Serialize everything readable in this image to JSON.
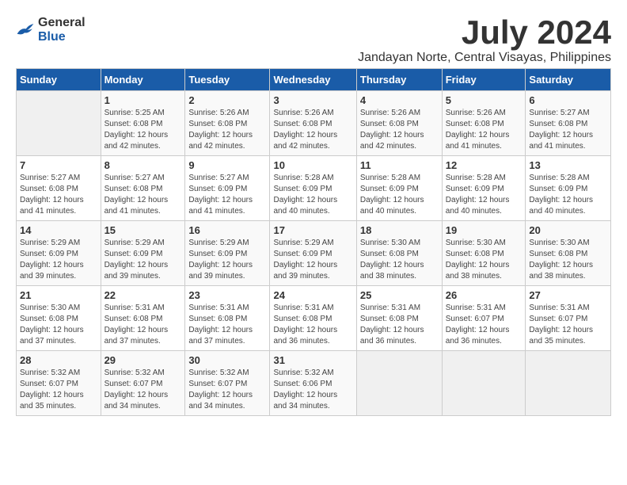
{
  "header": {
    "logo_general": "General",
    "logo_blue": "Blue",
    "title": "July 2024",
    "subtitle": "Jandayan Norte, Central Visayas, Philippines"
  },
  "calendar": {
    "days_of_week": [
      "Sunday",
      "Monday",
      "Tuesday",
      "Wednesday",
      "Thursday",
      "Friday",
      "Saturday"
    ],
    "weeks": [
      [
        {
          "day": "",
          "info": ""
        },
        {
          "day": "1",
          "info": "Sunrise: 5:25 AM\nSunset: 6:08 PM\nDaylight: 12 hours\nand 42 minutes."
        },
        {
          "day": "2",
          "info": "Sunrise: 5:26 AM\nSunset: 6:08 PM\nDaylight: 12 hours\nand 42 minutes."
        },
        {
          "day": "3",
          "info": "Sunrise: 5:26 AM\nSunset: 6:08 PM\nDaylight: 12 hours\nand 42 minutes."
        },
        {
          "day": "4",
          "info": "Sunrise: 5:26 AM\nSunset: 6:08 PM\nDaylight: 12 hours\nand 42 minutes."
        },
        {
          "day": "5",
          "info": "Sunrise: 5:26 AM\nSunset: 6:08 PM\nDaylight: 12 hours\nand 41 minutes."
        },
        {
          "day": "6",
          "info": "Sunrise: 5:27 AM\nSunset: 6:08 PM\nDaylight: 12 hours\nand 41 minutes."
        }
      ],
      [
        {
          "day": "7",
          "info": "Sunrise: 5:27 AM\nSunset: 6:08 PM\nDaylight: 12 hours\nand 41 minutes."
        },
        {
          "day": "8",
          "info": "Sunrise: 5:27 AM\nSunset: 6:08 PM\nDaylight: 12 hours\nand 41 minutes."
        },
        {
          "day": "9",
          "info": "Sunrise: 5:27 AM\nSunset: 6:09 PM\nDaylight: 12 hours\nand 41 minutes."
        },
        {
          "day": "10",
          "info": "Sunrise: 5:28 AM\nSunset: 6:09 PM\nDaylight: 12 hours\nand 40 minutes."
        },
        {
          "day": "11",
          "info": "Sunrise: 5:28 AM\nSunset: 6:09 PM\nDaylight: 12 hours\nand 40 minutes."
        },
        {
          "day": "12",
          "info": "Sunrise: 5:28 AM\nSunset: 6:09 PM\nDaylight: 12 hours\nand 40 minutes."
        },
        {
          "day": "13",
          "info": "Sunrise: 5:28 AM\nSunset: 6:09 PM\nDaylight: 12 hours\nand 40 minutes."
        }
      ],
      [
        {
          "day": "14",
          "info": "Sunrise: 5:29 AM\nSunset: 6:09 PM\nDaylight: 12 hours\nand 39 minutes."
        },
        {
          "day": "15",
          "info": "Sunrise: 5:29 AM\nSunset: 6:09 PM\nDaylight: 12 hours\nand 39 minutes."
        },
        {
          "day": "16",
          "info": "Sunrise: 5:29 AM\nSunset: 6:09 PM\nDaylight: 12 hours\nand 39 minutes."
        },
        {
          "day": "17",
          "info": "Sunrise: 5:29 AM\nSunset: 6:09 PM\nDaylight: 12 hours\nand 39 minutes."
        },
        {
          "day": "18",
          "info": "Sunrise: 5:30 AM\nSunset: 6:08 PM\nDaylight: 12 hours\nand 38 minutes."
        },
        {
          "day": "19",
          "info": "Sunrise: 5:30 AM\nSunset: 6:08 PM\nDaylight: 12 hours\nand 38 minutes."
        },
        {
          "day": "20",
          "info": "Sunrise: 5:30 AM\nSunset: 6:08 PM\nDaylight: 12 hours\nand 38 minutes."
        }
      ],
      [
        {
          "day": "21",
          "info": "Sunrise: 5:30 AM\nSunset: 6:08 PM\nDaylight: 12 hours\nand 37 minutes."
        },
        {
          "day": "22",
          "info": "Sunrise: 5:31 AM\nSunset: 6:08 PM\nDaylight: 12 hours\nand 37 minutes."
        },
        {
          "day": "23",
          "info": "Sunrise: 5:31 AM\nSunset: 6:08 PM\nDaylight: 12 hours\nand 37 minutes."
        },
        {
          "day": "24",
          "info": "Sunrise: 5:31 AM\nSunset: 6:08 PM\nDaylight: 12 hours\nand 36 minutes."
        },
        {
          "day": "25",
          "info": "Sunrise: 5:31 AM\nSunset: 6:08 PM\nDaylight: 12 hours\nand 36 minutes."
        },
        {
          "day": "26",
          "info": "Sunrise: 5:31 AM\nSunset: 6:07 PM\nDaylight: 12 hours\nand 36 minutes."
        },
        {
          "day": "27",
          "info": "Sunrise: 5:31 AM\nSunset: 6:07 PM\nDaylight: 12 hours\nand 35 minutes."
        }
      ],
      [
        {
          "day": "28",
          "info": "Sunrise: 5:32 AM\nSunset: 6:07 PM\nDaylight: 12 hours\nand 35 minutes."
        },
        {
          "day": "29",
          "info": "Sunrise: 5:32 AM\nSunset: 6:07 PM\nDaylight: 12 hours\nand 34 minutes."
        },
        {
          "day": "30",
          "info": "Sunrise: 5:32 AM\nSunset: 6:07 PM\nDaylight: 12 hours\nand 34 minutes."
        },
        {
          "day": "31",
          "info": "Sunrise: 5:32 AM\nSunset: 6:06 PM\nDaylight: 12 hours\nand 34 minutes."
        },
        {
          "day": "",
          "info": ""
        },
        {
          "day": "",
          "info": ""
        },
        {
          "day": "",
          "info": ""
        }
      ]
    ]
  }
}
